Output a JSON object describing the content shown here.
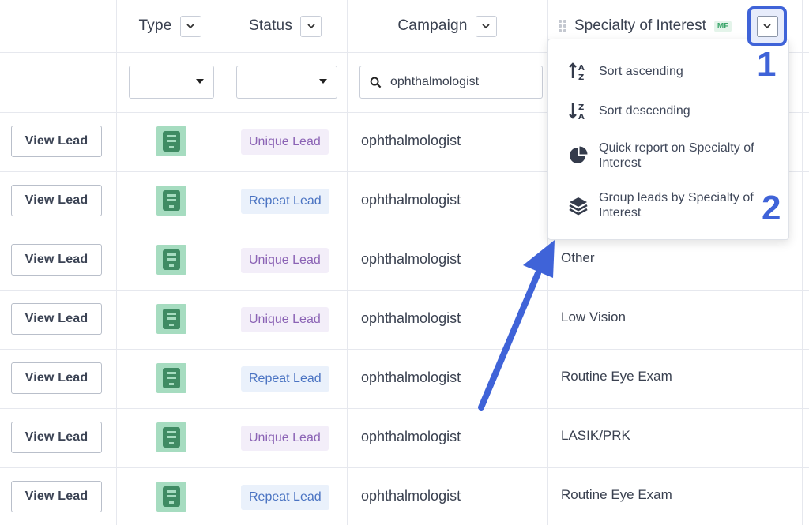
{
  "headers": {
    "type": "Type",
    "status": "Status",
    "campaign": "Campaign",
    "specialty": "Specialty of Interest",
    "specialty_badge": "MF"
  },
  "filters": {
    "search_value": "ophthalmologist"
  },
  "menu": {
    "items": [
      {
        "label": "Sort ascending",
        "icon": "sort-ascending-icon"
      },
      {
        "label": "Sort descending",
        "icon": "sort-descending-icon"
      },
      {
        "label": "Quick report on Specialty of Interest",
        "icon": "pie-chart-icon"
      },
      {
        "label": "Group leads by Specialty of Interest",
        "icon": "layers-icon"
      }
    ]
  },
  "annotations": {
    "step1": "1",
    "step2": "2"
  },
  "rows": [
    {
      "action": "View Lead",
      "status": "Unique Lead",
      "status_kind": "unique",
      "campaign": "ophthalmologist",
      "specialty": ""
    },
    {
      "action": "View Lead",
      "status": "Repeat Lead",
      "status_kind": "repeat",
      "campaign": "ophthalmologist",
      "specialty": ""
    },
    {
      "action": "View Lead",
      "status": "Unique Lead",
      "status_kind": "unique",
      "campaign": "ophthalmologist",
      "specialty": "Other"
    },
    {
      "action": "View Lead",
      "status": "Unique Lead",
      "status_kind": "unique",
      "campaign": "ophthalmologist",
      "specialty": "Low Vision"
    },
    {
      "action": "View Lead",
      "status": "Repeat Lead",
      "status_kind": "repeat",
      "campaign": "ophthalmologist",
      "specialty": "Routine Eye Exam"
    },
    {
      "action": "View Lead",
      "status": "Unique Lead",
      "status_kind": "unique",
      "campaign": "ophthalmologist",
      "specialty": "LASIK/PRK"
    },
    {
      "action": "View Lead",
      "status": "Repeat Lead",
      "status_kind": "repeat",
      "campaign": "ophthalmologist",
      "specialty": "Routine Eye Exam"
    }
  ],
  "colors": {
    "annotation": "#3f63d8",
    "unique_status": "#8b63b5",
    "repeat_status": "#4a73c2",
    "type_icon_bg": "#a6dcc0"
  }
}
